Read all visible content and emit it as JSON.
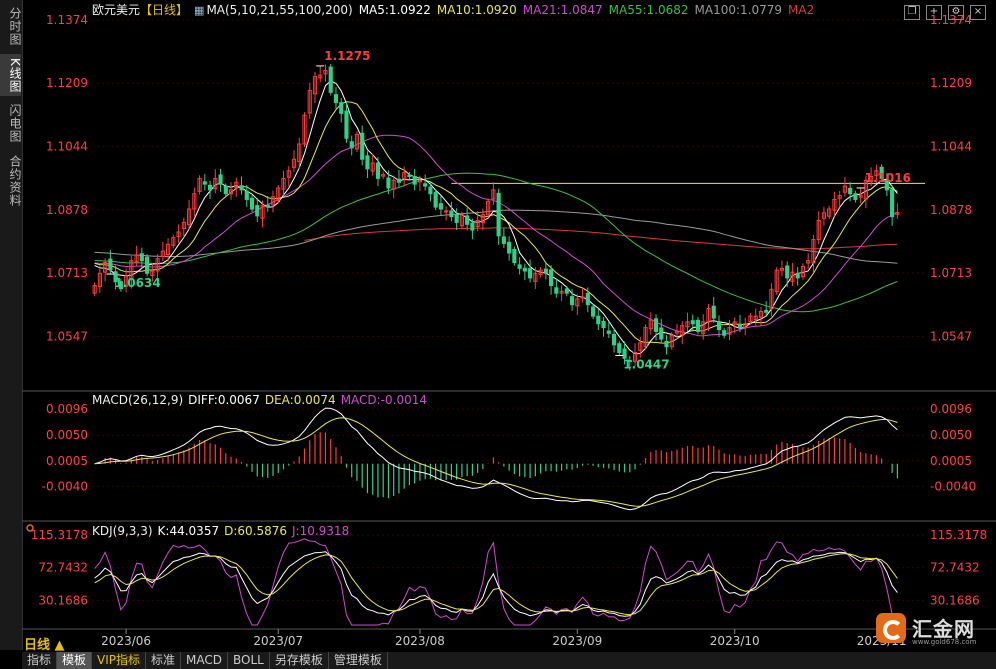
{
  "sidebar": [
    {
      "label": "分时图",
      "active": false
    },
    {
      "label": "K线图",
      "active": true
    },
    {
      "label": "闪电图",
      "active": false
    },
    {
      "label": "合约资料",
      "active": false
    }
  ],
  "header": {
    "symbol": "欧元美元",
    "period": "【日线】",
    "ma_label": "MA(5,10,21,55,100,200)",
    "ma5": "MA5:1.0922",
    "ma10": "MA10:1.0920",
    "ma21": "MA21:1.0847",
    "ma55": "MA55:1.0682",
    "ma100": "MA100:1.0779",
    "ma200": "MA2"
  },
  "macd_header": {
    "label": "MACD(26,12,9)",
    "diff": "DIFF:0.0067",
    "dea": "DEA:0.0074",
    "macd": "MACD:-0.0014"
  },
  "kdj_header": {
    "label": "KDJ(9,3,3)",
    "k": "K:44.0357",
    "d": "D:60.5876",
    "j": "J:10.9318"
  },
  "period_selector": "日线 ▲",
  "bottom_tabs": [
    "指标",
    "模板",
    "VIP指标",
    "标准",
    "MACD",
    "BOLL",
    "另存模板",
    "管理模板"
  ],
  "active_tab": "模板",
  "logo": {
    "name": "汇金网",
    "url": "www.gold678.com"
  },
  "colors": {
    "up": "#ff3b3b",
    "down": "#2fd08a",
    "ma5": "#ffffff",
    "ma10": "#e8e84a",
    "ma21": "#d04ad0",
    "ma55": "#3fbf3f",
    "ma100": "#9a9a9a",
    "ma200": "#d83a3a",
    "axis_price": "#ff4040",
    "grid": "#3a0000"
  },
  "chart_data": [
    {
      "type": "candlestick",
      "title": "欧元美元 日线",
      "x_labels": [
        "2023/06",
        "2023/07",
        "2023/08",
        "2023/09",
        "2023/10",
        "2023/11"
      ],
      "y_ticks": [
        1.1374,
        1.1209,
        1.1044,
        1.0878,
        1.0713,
        1.0547
      ],
      "ylim": [
        1.042,
        1.1374
      ],
      "annotations": [
        {
          "text": "1.1275",
          "type": "high"
        },
        {
          "text": "1.0634",
          "type": "low"
        },
        {
          "text": "1.0447",
          "type": "low"
        },
        {
          "text": "1.1016",
          "type": "high"
        }
      ],
      "horizontal_line": 1.0947,
      "close": [
        1.068,
        1.0712,
        1.074,
        1.0722,
        1.069,
        1.0672,
        1.0705,
        1.0745,
        1.076,
        1.0745,
        1.0712,
        1.0718,
        1.075,
        1.077,
        1.0788,
        1.0805,
        1.082,
        1.0845,
        1.088,
        1.092,
        1.096,
        1.0945,
        1.093,
        1.096,
        1.0945,
        1.092,
        1.093,
        1.095,
        1.093,
        1.0905,
        1.088,
        1.0862,
        1.089,
        1.0885,
        1.0912,
        1.0935,
        1.096,
        1.098,
        1.101,
        1.105,
        1.1125,
        1.119,
        1.1226,
        1.123,
        1.1242,
        1.1185,
        1.1158,
        1.113,
        1.1065,
        1.104,
        1.1075,
        1.101,
        1.0985,
        1.1,
        1.096,
        1.097,
        1.0935,
        1.0955,
        1.095,
        1.0975,
        1.0965,
        1.0945,
        1.0955,
        1.094,
        1.092,
        1.0885,
        1.088,
        1.0875,
        1.086,
        1.0845,
        1.0865,
        1.084,
        1.0825,
        1.085,
        1.0865,
        1.09,
        1.093,
        1.081,
        1.079,
        1.0765,
        1.074,
        1.0725,
        1.0718,
        1.07,
        1.0712,
        1.072,
        1.0712,
        1.068,
        1.066,
        1.0665,
        1.066,
        1.063,
        1.0645,
        1.065,
        1.063,
        1.06,
        1.058,
        1.057,
        1.0555,
        1.0525,
        1.0505,
        1.049,
        1.0482,
        1.0505,
        1.053,
        1.057,
        1.059,
        1.056,
        1.054,
        1.052,
        1.055,
        1.056,
        1.0575,
        1.0585,
        1.058,
        1.056,
        1.0585,
        1.062,
        1.0595,
        1.0565,
        1.055,
        1.057,
        1.0585,
        1.057,
        1.058,
        1.06,
        1.06,
        1.0612,
        1.061,
        1.067,
        1.072,
        1.0725,
        1.07,
        1.0715,
        1.07,
        1.073,
        1.0745,
        1.08,
        1.085,
        1.087,
        1.088,
        1.0905,
        1.0915,
        1.094,
        1.092,
        1.0905,
        1.0915,
        1.0955,
        1.0965,
        1.098,
        1.096,
        1.093,
        1.086,
        1.0871
      ]
    },
    {
      "type": "macd",
      "params": "26,12,9",
      "y_ticks": [
        0.0096,
        0.005,
        0.0005,
        -0.004
      ],
      "ylim": [
        -0.0085,
        0.0112
      ]
    },
    {
      "type": "kdj",
      "params": "9,3,3",
      "y_ticks": [
        115.3178,
        72.7432,
        30.1686
      ],
      "ylim": [
        -2,
        122
      ]
    }
  ]
}
